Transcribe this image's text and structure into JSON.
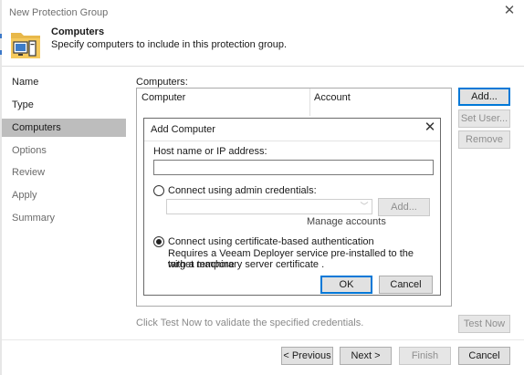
{
  "window": {
    "title": "New Protection Group",
    "close_icon": "close-icon"
  },
  "header": {
    "title": "Computers",
    "subtitle": "Specify computers to include in this protection group.",
    "icon": "computer-folder-icon"
  },
  "nav": {
    "items": [
      {
        "label": "Name",
        "state": "done"
      },
      {
        "label": "Type",
        "state": "done"
      },
      {
        "label": "Computers",
        "state": "active"
      },
      {
        "label": "Options",
        "state": "pending"
      },
      {
        "label": "Review",
        "state": "pending"
      },
      {
        "label": "Apply",
        "state": "pending"
      },
      {
        "label": "Summary",
        "state": "pending"
      }
    ]
  },
  "main": {
    "computers_label": "Computers:",
    "columns": [
      "Computer",
      "Account"
    ],
    "buttons": {
      "add": "Add...",
      "set_user": "Set User...",
      "remove": "Remove",
      "test_now": "Test Now"
    },
    "hint": "Click Test Now to validate the specified credentials."
  },
  "dialog": {
    "title": "Add Computer",
    "host_label": "Host name or IP address:",
    "host_value": "",
    "option_admin": "Connect using admin credentials:",
    "credentials_value": "",
    "add_button": "Add...",
    "manage_accounts": "Manage accounts",
    "option_cert": "Connect using certificate-based authentication",
    "cert_desc_line1": "Requires a Veeam Deployer service pre-installed to the target machine",
    "cert_desc_line2": "with a temporary server certificate .",
    "selected_option": "certificate",
    "ok": "OK",
    "cancel": "Cancel"
  },
  "footer": {
    "previous": "< Previous",
    "next": "Next >",
    "finish": "Finish",
    "cancel": "Cancel"
  },
  "colors": {
    "focus_border": "#0078d7",
    "nav_active": "#bdbdbd"
  }
}
